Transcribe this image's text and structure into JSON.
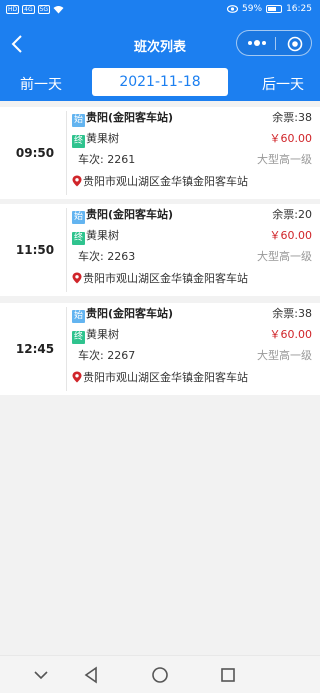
{
  "status_bar": {
    "left_chips": [
      "HD",
      "4G",
      "5G"
    ],
    "battery_percent": "59%",
    "time": "16:25"
  },
  "header": {
    "title": "班次列表",
    "back_icon": "chevron-left-icon",
    "more_icon": "more-dots-icon",
    "close_icon": "target-circle-icon"
  },
  "date_bar": {
    "prev_label": "前一天",
    "current_date": "2021-11-18",
    "next_label": "后一天"
  },
  "labels": {
    "start_tag": "始",
    "end_tag": "终",
    "seats_prefix": "余票:",
    "trip_prefix": "车次:"
  },
  "trips": [
    {
      "time": "09:50",
      "from": "贵阳(金阳客车站)",
      "to": "黄果树",
      "seats": "38",
      "price": "￥60.00",
      "trip_no": "2261",
      "bus_class": "大型高一级",
      "address": "贵阳市观山湖区金华镇金阳客车站"
    },
    {
      "time": "11:50",
      "from": "贵阳(金阳客车站)",
      "to": "黄果树",
      "seats": "20",
      "price": "￥60.00",
      "trip_no": "2263",
      "bus_class": "大型高一级",
      "address": "贵阳市观山湖区金华镇金阳客车站"
    },
    {
      "time": "12:45",
      "from": "贵阳(金阳客车站)",
      "to": "黄果树",
      "seats": "38",
      "price": "￥60.00",
      "trip_no": "2267",
      "bus_class": "大型高一级",
      "address": "贵阳市观山湖区金华镇金阳客车站"
    }
  ],
  "colors": {
    "primary": "#1c7ff0",
    "price": "#d0252a",
    "start_tag": "#63b4f0",
    "end_tag": "#2fc38e"
  },
  "bottom_nav": [
    "chevron-down-icon",
    "back-triangle-icon",
    "home-circle-icon",
    "recents-square-icon"
  ]
}
